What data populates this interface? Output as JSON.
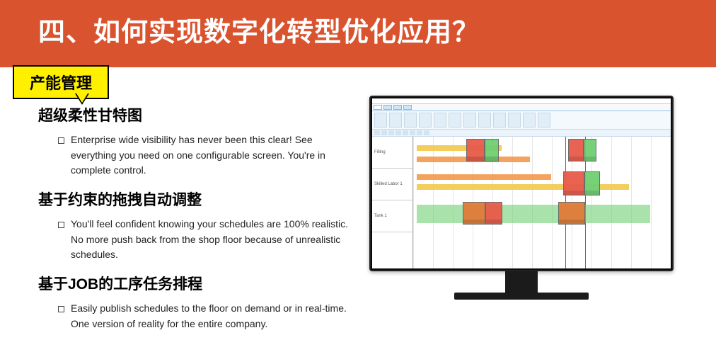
{
  "header": {
    "title": "四、如何实现数字化转型优化应用？"
  },
  "callout": {
    "label": "产能管理"
  },
  "sections": [
    {
      "heading": "超级柔性甘特图",
      "bullet": "Enterprise wide visibility has never been this clear!  See everything you need on one configurable screen. You're in complete control."
    },
    {
      "heading": "基于约束的拖拽自动调整",
      "bullet": "You'll feel confident knowing your schedules are 100% realistic. No more push back from the shop floor because of unrealistic schedules."
    },
    {
      "heading": "基于JOB的工序任务排程",
      "bullet": "Easily publish schedules to the floor on demand or in real-time. One version of reality for the entire company."
    }
  ],
  "gantt_preview": {
    "rows": [
      "Filling",
      "Skilled Labor 1",
      "Tank 1"
    ]
  }
}
